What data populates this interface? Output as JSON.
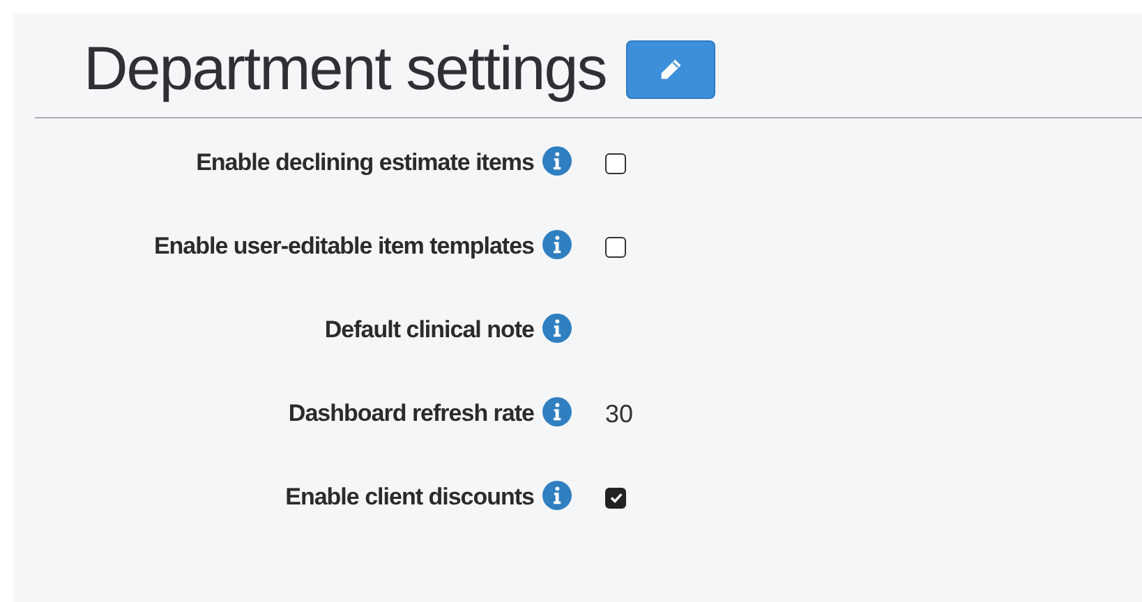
{
  "page": {
    "title": "Department settings"
  },
  "settings": [
    {
      "label": "Enable declining estimate items",
      "kind": "checkbox",
      "checked": false
    },
    {
      "label": "Enable user-editable item templates",
      "kind": "checkbox",
      "checked": false
    },
    {
      "label": "Default clinical note",
      "kind": "empty"
    },
    {
      "label": "Dashboard refresh rate",
      "kind": "text",
      "value": "30"
    },
    {
      "label": "Enable client discounts",
      "kind": "checkbox",
      "checked": true
    }
  ]
}
